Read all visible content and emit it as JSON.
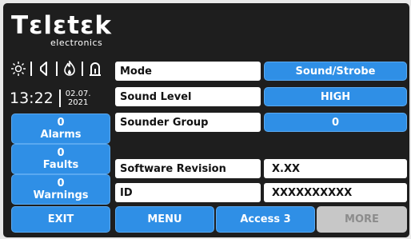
{
  "brand": {
    "name": "Tεlεtεk",
    "tagline": "electronics"
  },
  "status_icons": [
    "sun-icon",
    "speaker-icon",
    "fire-icon",
    "siren-icon"
  ],
  "clock": {
    "time": "13:22",
    "date_line1": "02.07.",
    "date_line2": "2021"
  },
  "left_buttons": {
    "alarms": {
      "count": "0",
      "label": "Alarms"
    },
    "faults": {
      "count": "0",
      "label": "Faults"
    },
    "warnings": {
      "count": "0",
      "label": "Warnings"
    }
  },
  "settings": {
    "mode": {
      "label": "Mode",
      "value": "Sound/Strobe"
    },
    "sound_level": {
      "label": "Sound Level",
      "value": "HIGH"
    },
    "sounder_group": {
      "label": "Sounder Group",
      "value": "0"
    },
    "software_revision": {
      "label": "Software Revision",
      "value": "X.XX"
    },
    "id": {
      "label": "ID",
      "value": "XXXXXXXXXX"
    }
  },
  "bottom_bar": {
    "exit": "EXIT",
    "menu": "MENU",
    "access": "Access 3",
    "more": "MORE"
  },
  "colors": {
    "accent": "#2f8fe6",
    "background": "#1e1e1e",
    "disabled": "#c7c7c7"
  }
}
